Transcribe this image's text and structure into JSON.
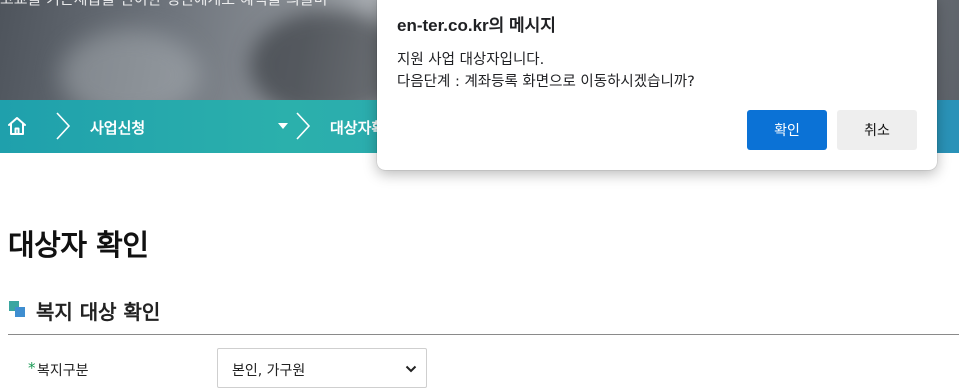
{
  "hero": {
    "text": "고교틀 키는세급을 면이한 생인에게도 혜택을 의골미"
  },
  "navbar": {
    "home_icon": "home-icon",
    "items": [
      {
        "label": "사업신청"
      },
      {
        "label": "대상자확"
      }
    ]
  },
  "page": {
    "title": "대상자 확인",
    "section_title": "복지 대상 확인",
    "field": {
      "required_mark": "*",
      "label": "복지구분",
      "selected_value": "본인, 가구원"
    }
  },
  "dialog": {
    "title": "en-ter.co.kr의 메시지",
    "message_line1": "지원 사업 대상자입니다.",
    "message_line2": "다음단계 : 계좌등록 화면으로 이동하시겠습니까?",
    "ok_label": "확인",
    "cancel_label": "취소"
  },
  "colors": {
    "nav_bar": "#2aa6b0",
    "ok_button": "#0b72d6",
    "cancel_button": "#eeeeee",
    "required_mark": "#1a9a55"
  }
}
